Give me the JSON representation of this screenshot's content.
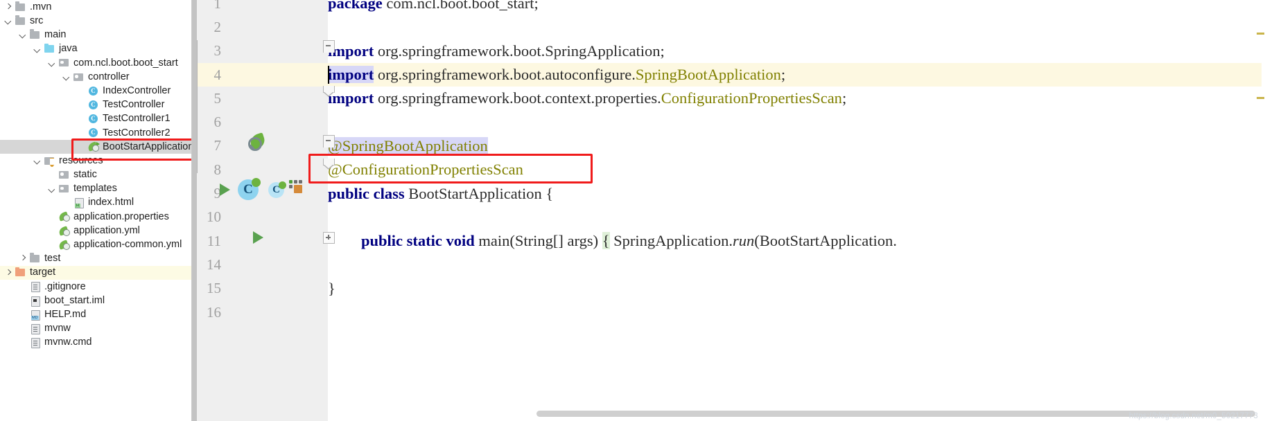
{
  "sidebar": {
    "tree": [
      {
        "label": ".mvn",
        "depth": 0,
        "arrow": "right",
        "icon": "folder-grey-icon"
      },
      {
        "label": "src",
        "depth": 0,
        "arrow": "down",
        "icon": "folder-grey-icon"
      },
      {
        "label": "main",
        "depth": 1,
        "arrow": "down",
        "icon": "folder-grey-icon"
      },
      {
        "label": "java",
        "depth": 2,
        "arrow": "down",
        "icon": "folder-blue-icon"
      },
      {
        "label": "com.ncl.boot.boot_start",
        "depth": 3,
        "arrow": "down",
        "icon": "folder-package-icon"
      },
      {
        "label": "controller",
        "depth": 4,
        "arrow": "down",
        "icon": "folder-package-icon"
      },
      {
        "label": "IndexController",
        "depth": 5,
        "arrow": "none",
        "icon": "java-class-icon"
      },
      {
        "label": "TestController",
        "depth": 5,
        "arrow": "none",
        "icon": "java-class-icon"
      },
      {
        "label": "TestController1",
        "depth": 5,
        "arrow": "none",
        "icon": "java-class-icon"
      },
      {
        "label": "TestController2",
        "depth": 5,
        "arrow": "none",
        "icon": "java-class-icon"
      },
      {
        "label": "BootStartApplication",
        "depth": 5,
        "arrow": "none",
        "icon": "spring-boot-run-icon",
        "state": "selected",
        "boxed": true
      },
      {
        "label": "resources",
        "depth": 2,
        "arrow": "down",
        "icon": "folder-resources-icon"
      },
      {
        "label": "static",
        "depth": 3,
        "arrow": "none",
        "icon": "folder-package-icon"
      },
      {
        "label": "templates",
        "depth": 3,
        "arrow": "down",
        "icon": "folder-package-icon"
      },
      {
        "label": "index.html",
        "depth": 4,
        "arrow": "none",
        "icon": "html-file-icon"
      },
      {
        "label": "application.properties",
        "depth": 3,
        "arrow": "none",
        "icon": "spring-config-icon"
      },
      {
        "label": "application.yml",
        "depth": 3,
        "arrow": "none",
        "icon": "spring-config-icon"
      },
      {
        "label": "application-common.yml",
        "depth": 3,
        "arrow": "none",
        "icon": "spring-config-icon"
      },
      {
        "label": "test",
        "depth": 1,
        "arrow": "right",
        "icon": "folder-grey-icon"
      },
      {
        "label": "target",
        "depth": 0,
        "arrow": "right",
        "icon": "folder-orange-icon",
        "state": "highlighted"
      },
      {
        "label": ".gitignore",
        "depth": 1,
        "arrow": "none",
        "icon": "text-file-icon"
      },
      {
        "label": "boot_start.iml",
        "depth": 1,
        "arrow": "none",
        "icon": "iml-file-icon"
      },
      {
        "label": "HELP.md",
        "depth": 1,
        "arrow": "none",
        "icon": "markdown-file-icon"
      },
      {
        "label": "mvnw",
        "depth": 1,
        "arrow": "none",
        "icon": "text-file-icon"
      },
      {
        "label": "mvnw.cmd",
        "depth": 1,
        "arrow": "none",
        "icon": "text-file-icon"
      }
    ]
  },
  "editor": {
    "lines": [
      {
        "num": "1",
        "text": "package com.ncl.boot.boot_start;"
      },
      {
        "num": "2",
        "text": ""
      },
      {
        "num": "3",
        "text": "import org.springframework.boot.SpringApplication;"
      },
      {
        "num": "4",
        "text": "import org.springframework.boot.autoconfigure.SpringBootApplication;"
      },
      {
        "num": "5",
        "text": "import org.springframework.boot.context.properties.ConfigurationPropertiesScan;"
      },
      {
        "num": "6",
        "text": ""
      },
      {
        "num": "7",
        "text": "@SpringBootApplication"
      },
      {
        "num": "8",
        "text": "@ConfigurationPropertiesScan"
      },
      {
        "num": "9",
        "text": "public class BootStartApplication {"
      },
      {
        "num": "10",
        "text": ""
      },
      {
        "num": "11",
        "text": "    public static void main(String[] args) { SpringApplication.run(BootStartApplication."
      },
      {
        "num": "14",
        "text": ""
      },
      {
        "num": "15",
        "text": "}"
      },
      {
        "num": "16",
        "text": ""
      }
    ],
    "tokens": {
      "kw_package": "package",
      "kw_import": "import",
      "kw_public": "public",
      "kw_class": "class",
      "kw_static": "static",
      "kw_void": "void",
      "pkg_name": " com.ncl.boot.boot_start;",
      "imp3_rest": " org.springframework.boot.SpringApplication;",
      "imp4_mid": " org.springframework.boot.autoconfigure.",
      "imp4_cls": "SpringBootApplication",
      "imp4_end": ";",
      "imp5_mid": " org.springframework.boot.context.properties.",
      "imp5_cls": "ConfigurationPropertiesScan",
      "imp5_end": ";",
      "anno7": "@SpringBootApplication",
      "anno8": "@ConfigurationPropertiesScan",
      "class_decl_name": " BootStartApplication {",
      "main_sig": "main(String[] args)",
      "brace_open": "{",
      "spring_app": " SpringApplication.",
      "run_method": "run",
      "run_args": "(BootStartApplication.",
      "class_name": "BootStartApplication"
    },
    "watermark": "https://blog.csdn.net/m0_50217773"
  },
  "colors": {
    "keyword": "#000080",
    "class_ref": "#808000",
    "selection": "#d7d7f7",
    "caret_line": "#fdf8e1",
    "red_box": "#f01b1b",
    "target_highlight": "#fdfbe4",
    "tree_selected": "#d6d6d6",
    "brace_match": "#dff0d8"
  }
}
